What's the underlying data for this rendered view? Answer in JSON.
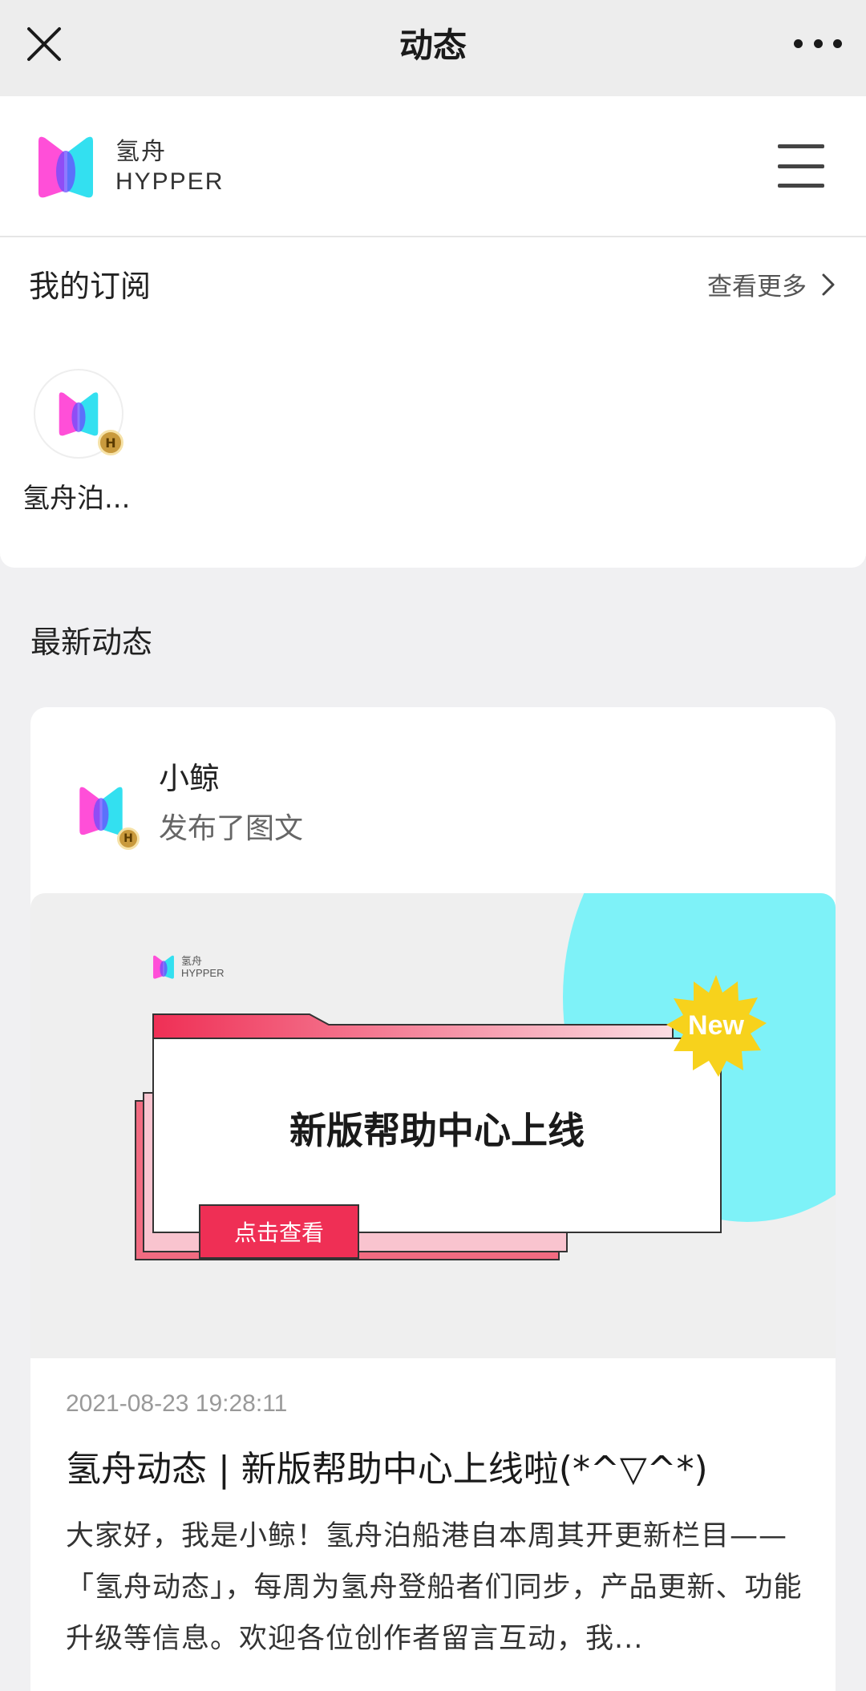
{
  "topbar": {
    "title": "动态"
  },
  "site": {
    "brand_cn": "氢舟",
    "brand_en": "HYPPER"
  },
  "subscriptions": {
    "title": "我的订阅",
    "more_label": "查看更多",
    "items": [
      {
        "name": "氢舟泊..."
      }
    ]
  },
  "latest": {
    "title": "最新动态",
    "post": {
      "author": "小鲸",
      "action": "发布了图文",
      "banner": {
        "brand_cn": "氢舟",
        "brand_en": "HYPPER",
        "headline": "新版帮助中心上线",
        "button": "点击查看",
        "new_label": "New"
      },
      "time": "2021-08-23 19:28:11",
      "title": "氢舟动态 | 新版帮助中心上线啦(*^▽^*)",
      "body": "大家好，我是小鲸！氢舟泊船港自本周其开更新栏目——「氢舟动态」，每周为氢舟登船者们同步，产品更新、功能升级等信息。欢迎各位创作者留言互动，我..."
    }
  },
  "colors": {
    "brand_pink": "#ff4fd8",
    "brand_cyan": "#33e0f0",
    "accent_red": "#ef2f55",
    "badge_gold": "#c99a3d"
  }
}
